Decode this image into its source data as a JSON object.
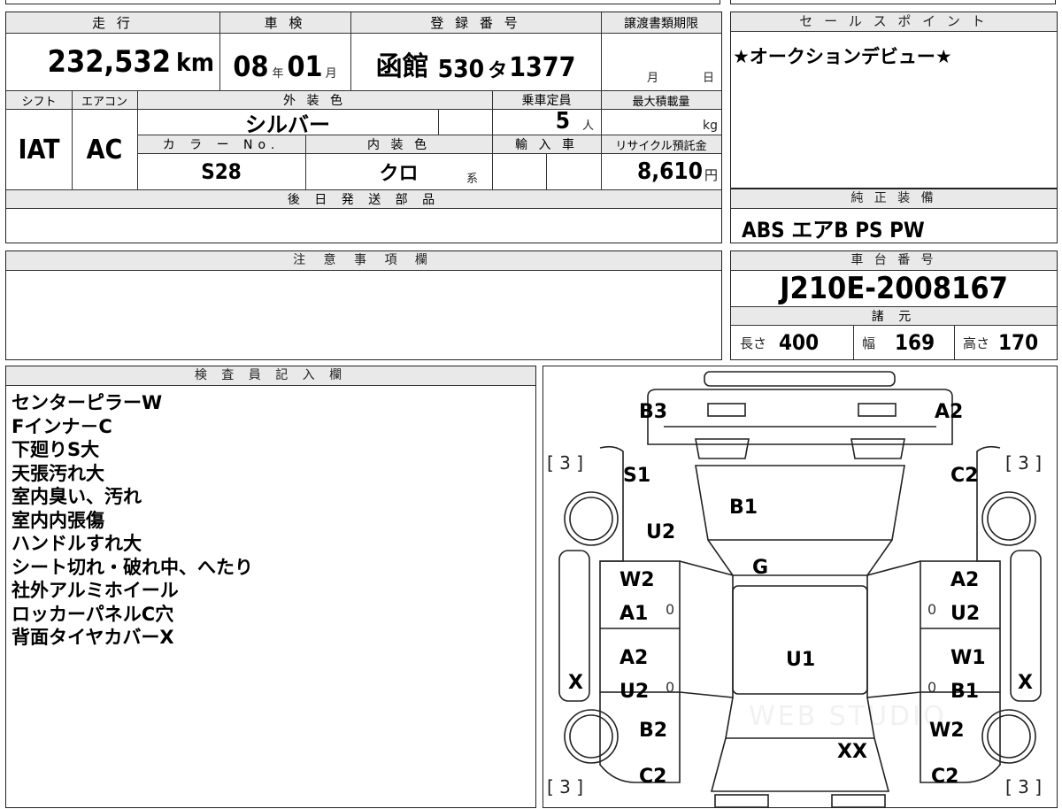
{
  "header": {
    "mileage_label": "走 行",
    "inspection_label": "車 検",
    "registration_label": "登 録 番 号",
    "transfer_deadline_label": "譲渡書類期限",
    "sales_point_label": "セ ー ル ス ポ イ ン ト"
  },
  "vehicle": {
    "mileage_value": "232,532",
    "mileage_unit": "km",
    "inspection_year": "08",
    "year_unit": "年",
    "inspection_month": "01",
    "month_unit": "月",
    "registration_region": "函館",
    "registration_class": "530",
    "registration_kana": "タ",
    "registration_number": "1377",
    "deadline_month_unit": "月",
    "deadline_day_unit": "日",
    "shift_label": "シフト",
    "aircon_label": "エアコン",
    "exterior_color_label": "外 装 色",
    "capacity_label": "乗車定員",
    "max_load_label": "最大積載量",
    "shift_value": "IAT",
    "aircon_value": "AC",
    "exterior_color_value": "シルバー",
    "capacity_value": "5",
    "capacity_unit": "人",
    "load_unit": "kg",
    "color_no_label": "カ ラ ー No.",
    "interior_color_label": "内 装 色",
    "import_label": "輸 入 車",
    "recycle_label": "リサイクル預託金",
    "color_no_value": "S28",
    "interior_color_value": "クロ",
    "interior_color_suffix": "系",
    "recycle_value": "8,610",
    "recycle_unit": "円",
    "later_parts_label": "後 日 発 送 部 品"
  },
  "sales_point": {
    "text": "★オークションデビュー★"
  },
  "equipment": {
    "label": "純 正 装 備",
    "value": "ABS エアB PS PW"
  },
  "caution": {
    "label": "注 意 事 項 欄"
  },
  "chassis": {
    "label": "車 台 番 号",
    "value": "J210E-2008167",
    "specs_label": "諸 元",
    "length_label": "長さ",
    "length_value": "400",
    "width_label": "幅",
    "width_value": "169",
    "height_label": "高さ",
    "height_value": "170"
  },
  "inspector": {
    "label": "検 査 員 記 入 欄",
    "notes": [
      "センターピラーW",
      "Fインナ－C",
      "下廻りS大",
      "天張汚れ大",
      "室内臭い、汚れ",
      "室内内張傷",
      "ハンドルすれ大",
      "シート切れ・破れ中、へたり",
      "社外アルミホイール",
      "ロッカーパネルC穴",
      "背面タイヤカバーX"
    ]
  },
  "diagram": {
    "tire_tread": "[ 3 ]",
    "marks": {
      "rear_left": "B3",
      "rear_right": "A2",
      "rear_qtr_left": "S1",
      "rear_qtr_right": "C2",
      "roof": "B1",
      "rear_pillar_left": "U2",
      "rear_glass": "G",
      "rear_door_left_1": "W2",
      "rear_door_left_2": "A1",
      "rear_door_right_1": "A2",
      "rear_door_right_2": "U2",
      "roof_center": "U1",
      "front_door_left_1": "A2",
      "front_door_left_2": "U2",
      "front_door_right_1": "W1",
      "front_door_right_2": "B1",
      "side_left": "X",
      "side_right": "X",
      "front_fender_left": "B2",
      "front_fender_right": "W2",
      "hood": "XX",
      "front_left": "C2",
      "front_right": "C2",
      "zero": "0"
    },
    "watermark": "WEB STUDIO"
  }
}
